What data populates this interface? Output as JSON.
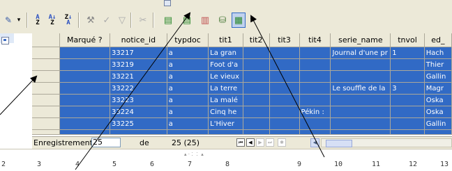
{
  "grid": {
    "columns": [
      "Marqué ?",
      "notice_id",
      "typdoc",
      "tit1",
      "tit2",
      "tit3",
      "tit4",
      "serie_name",
      "tnvol",
      "ed_"
    ],
    "rows": [
      [
        "",
        "33217",
        "a",
        "La gran",
        "",
        "",
        "",
        "Journal d'une pr",
        "1",
        "Hach"
      ],
      [
        "",
        "33219",
        "a",
        "Foot d'a",
        "",
        "",
        "",
        "",
        "",
        "Thier"
      ],
      [
        "",
        "33221",
        "a",
        "Le vieux",
        "",
        "",
        "",
        "",
        "",
        "Gallin"
      ],
      [
        "",
        "33222",
        "a",
        "La terre",
        "",
        "",
        "",
        "Le souffle de la",
        "3",
        "Magr"
      ],
      [
        "",
        "33223",
        "a",
        "La malé",
        "",
        "",
        "",
        "",
        "",
        "Oska"
      ],
      [
        "",
        "33224",
        "a",
        "Cinq he",
        "",
        "",
        "Pékin : ",
        "",
        "",
        "Oska"
      ],
      [
        "",
        "33225",
        "a",
        "L'Hiver",
        "",
        "",
        "",
        "",
        "",
        "Gallin"
      ]
    ]
  },
  "statusbar": {
    "record_label": "Enregistrement",
    "record_value": "25",
    "of_label": "de",
    "total": "25 (25)"
  },
  "ruler": {
    "marks": [
      "2",
      "3",
      "4",
      "5",
      "6",
      "7",
      "8",
      "9",
      "10",
      "11",
      "12",
      "13"
    ]
  },
  "colors": {
    "selection": "#316ac5",
    "chrome": "#ece9d8"
  },
  "icons": {
    "toolbar": [
      "form-icon",
      "sort-ascending-icon",
      "sort-az-icon",
      "sort-za-icon",
      "autofilter-icon",
      "standard-filter-icon",
      "filter-icon",
      "remove-filter-icon",
      "insert-columns-icon",
      "insert-fields-icon",
      "data-to-text-icon",
      "data-source-icon",
      "explorer-icon"
    ]
  }
}
